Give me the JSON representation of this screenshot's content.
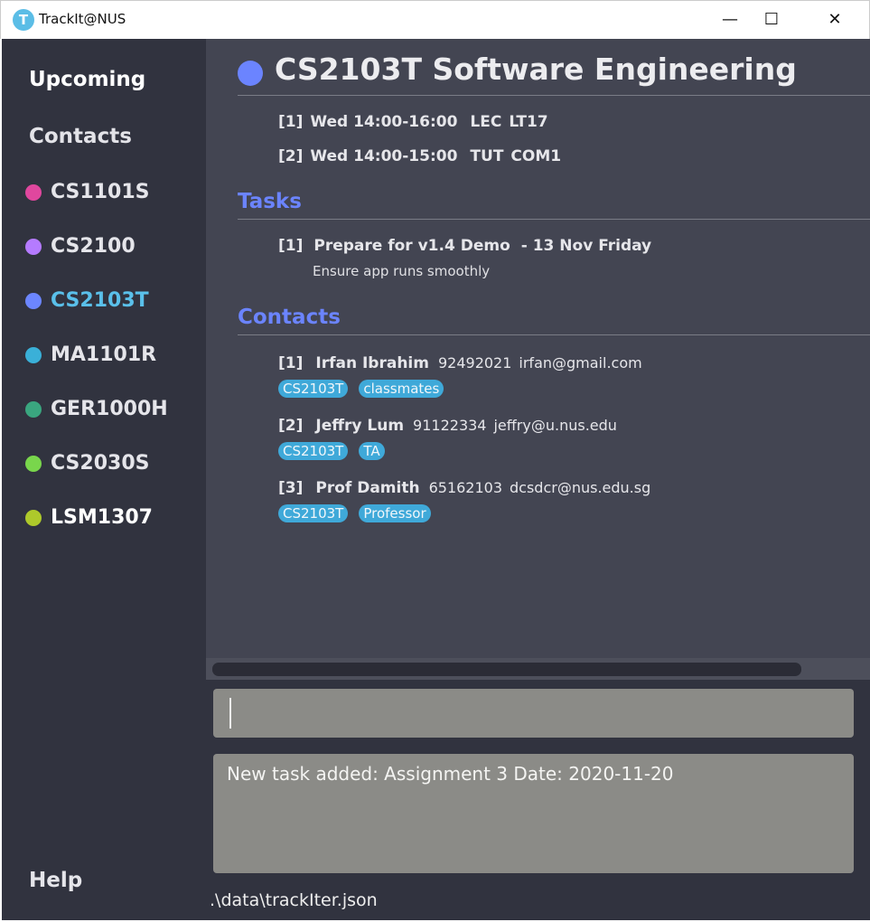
{
  "window": {
    "title": "TrackIt@NUS",
    "icon_letter": "T",
    "minimize": "—",
    "maximize": "☐",
    "close": "✕"
  },
  "sidebar": {
    "upcoming": "Upcoming",
    "contacts": "Contacts",
    "help": "Help",
    "modules": [
      {
        "code": "CS1101S",
        "color": "#e0479e"
      },
      {
        "code": "CS2100",
        "color": "#b57bff"
      },
      {
        "code": "CS2103T",
        "color": "#6c86ff",
        "selected": true
      },
      {
        "code": "MA1101R",
        "color": "#3ab0d8"
      },
      {
        "code": "GER1000H",
        "color": "#3aa67f"
      },
      {
        "code": "CS2030S",
        "color": "#79d64c"
      },
      {
        "code": "LSM1307",
        "color": "#aec92b"
      }
    ]
  },
  "module": {
    "title": "CS2103T Software Engineering",
    "color": "#6b84ff",
    "lessons": [
      {
        "index": "[1]",
        "time": "Wed 14:00-16:00",
        "type": "LEC",
        "venue": "LT17"
      },
      {
        "index": "[2]",
        "time": "Wed 14:00-15:00",
        "type": "TUT",
        "venue": "COM1"
      }
    ],
    "tasks_heading": "Tasks",
    "tasks": [
      {
        "index": "[1]",
        "name": "Prepare for v1.4 Demo",
        "date": "- 13 Nov Friday",
        "description": "Ensure app runs smoothly"
      }
    ],
    "contacts_heading": "Contacts",
    "contacts": [
      {
        "index": "[1]",
        "name": "Irfan Ibrahim",
        "phone": "92492021",
        "email": "irfan@gmail.com",
        "tags": [
          "CS2103T",
          "classmates"
        ]
      },
      {
        "index": "[2]",
        "name": "Jeffry Lum",
        "phone": "91122334",
        "email": "jeffry@u.nus.edu",
        "tags": [
          "CS2103T",
          "TA"
        ]
      },
      {
        "index": "[3]",
        "name": "Prof Damith",
        "phone": "65162103",
        "email": "dcsdcr@nus.edu.sg",
        "tags": [
          "CS2103T",
          "Professor"
        ]
      }
    ]
  },
  "command": {
    "value": ""
  },
  "result": {
    "text": "New task added: Assignment 3 Date: 2020-11-20"
  },
  "status": {
    "path": ".\\data\\trackIter.json"
  }
}
